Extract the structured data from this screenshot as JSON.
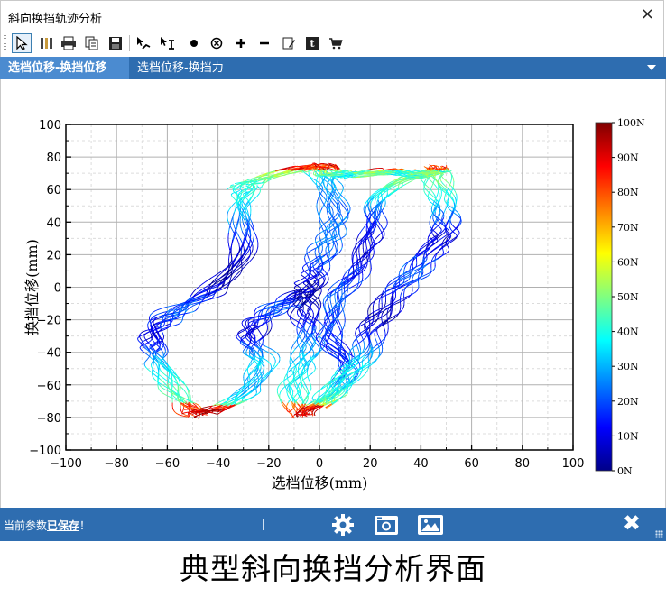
{
  "window": {
    "title": "斜向换挡轨迹分析",
    "close_glyph": "×"
  },
  "toolbar": {
    "tools": [
      {
        "name": "pointer-icon",
        "active": true
      },
      {
        "name": "tools-icon"
      },
      {
        "name": "printer-icon"
      },
      {
        "name": "copy-icon"
      },
      {
        "name": "save-icon"
      },
      {
        "name": "trace-icon"
      },
      {
        "name": "cursor-measure-icon"
      },
      {
        "name": "point-icon"
      },
      {
        "name": "cancel-icon"
      },
      {
        "name": "plus-icon"
      },
      {
        "name": "minus-icon"
      },
      {
        "name": "edit-icon"
      },
      {
        "name": "text-icon"
      },
      {
        "name": "cart-icon"
      }
    ]
  },
  "tabs": [
    {
      "label": "选档位移-换挡位移",
      "active": true
    },
    {
      "label": "选档位移-换挡力",
      "active": false
    }
  ],
  "chart_data": {
    "type": "line",
    "xlabel": "选档位移(mm)",
    "ylabel": "换挡位移(mm)",
    "xlim": [
      -100,
      100
    ],
    "ylim": [
      -100,
      100
    ],
    "x_ticks": [
      "−100",
      "−80",
      "−60",
      "−40",
      "−20",
      "0",
      "20",
      "40",
      "60",
      "80",
      "100"
    ],
    "y_ticks": [
      "100",
      "80",
      "60",
      "40",
      "20",
      "0",
      "−20",
      "−40",
      "−60",
      "−80",
      "−100"
    ],
    "grid": true,
    "colorbar": {
      "title": "",
      "min": 0,
      "max": 100,
      "labels": [
        "100N",
        "90N",
        "80N",
        "70N",
        "60N",
        "50N",
        "40N",
        "30N",
        "20N",
        "10N",
        "0N"
      ],
      "colors": [
        "#000088",
        "#0000ff",
        "#0080ff",
        "#00ffff",
        "#80ff80",
        "#ffff00",
        "#ff8000",
        "#ff0000",
        "#800000"
      ]
    },
    "trajectories": [
      {
        "gate": "left",
        "path": [
          {
            "x": -28,
            "y": 62
          },
          {
            "x": -30,
            "y": 50
          },
          {
            "x": -30,
            "y": 20
          },
          {
            "x": -40,
            "y": 0
          },
          {
            "x": -52,
            "y": -12
          },
          {
            "x": -62,
            "y": -22
          },
          {
            "x": -65,
            "y": -33
          },
          {
            "x": -63,
            "y": -45
          },
          {
            "x": -56,
            "y": -64
          },
          {
            "x": -48,
            "y": -78
          }
        ]
      },
      {
        "gate": "lower-left",
        "path": [
          {
            "x": -48,
            "y": -78
          },
          {
            "x": -38,
            "y": -75
          },
          {
            "x": -28,
            "y": -65
          },
          {
            "x": -22,
            "y": -48
          },
          {
            "x": -26,
            "y": -35
          },
          {
            "x": -24,
            "y": -22
          },
          {
            "x": -14,
            "y": -12
          },
          {
            "x": -4,
            "y": -3
          }
        ]
      },
      {
        "gate": "center-upper",
        "path": [
          {
            "x": -30,
            "y": 62
          },
          {
            "x": -20,
            "y": 68
          },
          {
            "x": -10,
            "y": 72
          },
          {
            "x": 0,
            "y": 74
          },
          {
            "x": 4,
            "y": 60
          },
          {
            "x": 6,
            "y": 40
          },
          {
            "x": 2,
            "y": 25
          },
          {
            "x": -2,
            "y": 10
          },
          {
            "x": -4,
            "y": 0
          },
          {
            "x": -6,
            "y": -12
          },
          {
            "x": -4,
            "y": -28
          },
          {
            "x": -6,
            "y": -45
          },
          {
            "x": -10,
            "y": -62
          },
          {
            "x": -8,
            "y": -78
          }
        ]
      },
      {
        "gate": "center-lower",
        "path": [
          {
            "x": -8,
            "y": -78
          },
          {
            "x": 0,
            "y": -72
          },
          {
            "x": 8,
            "y": -62
          },
          {
            "x": 10,
            "y": -48
          },
          {
            "x": 4,
            "y": -30
          },
          {
            "x": 6,
            "y": -10
          },
          {
            "x": 14,
            "y": 10
          },
          {
            "x": 20,
            "y": 30
          },
          {
            "x": 22,
            "y": 50
          },
          {
            "x": 30,
            "y": 64
          },
          {
            "x": 42,
            "y": 70
          },
          {
            "x": 46,
            "y": 72
          }
        ]
      },
      {
        "gate": "right",
        "path": [
          {
            "x": 46,
            "y": 72
          },
          {
            "x": 48,
            "y": 55
          },
          {
            "x": 50,
            "y": 38
          },
          {
            "x": 46,
            "y": 25
          },
          {
            "x": 38,
            "y": 10
          },
          {
            "x": 30,
            "y": -5
          },
          {
            "x": 22,
            "y": -22
          },
          {
            "x": 18,
            "y": -40
          },
          {
            "x": 10,
            "y": -56
          },
          {
            "x": 0,
            "y": -72
          }
        ]
      },
      {
        "gate": "upper-crossover",
        "path": [
          {
            "x": 0,
            "y": 74
          },
          {
            "x": 6,
            "y": 68
          },
          {
            "x": 16,
            "y": 70
          },
          {
            "x": 28,
            "y": 70
          },
          {
            "x": 40,
            "y": 70
          },
          {
            "x": 46,
            "y": 72
          }
        ]
      }
    ]
  },
  "status": {
    "text_prefix": "当前参数",
    "text_saved": "已保存",
    "text_suffix": "！",
    "close_glyph": "✖"
  },
  "caption": "典型斜向换挡分析界面"
}
